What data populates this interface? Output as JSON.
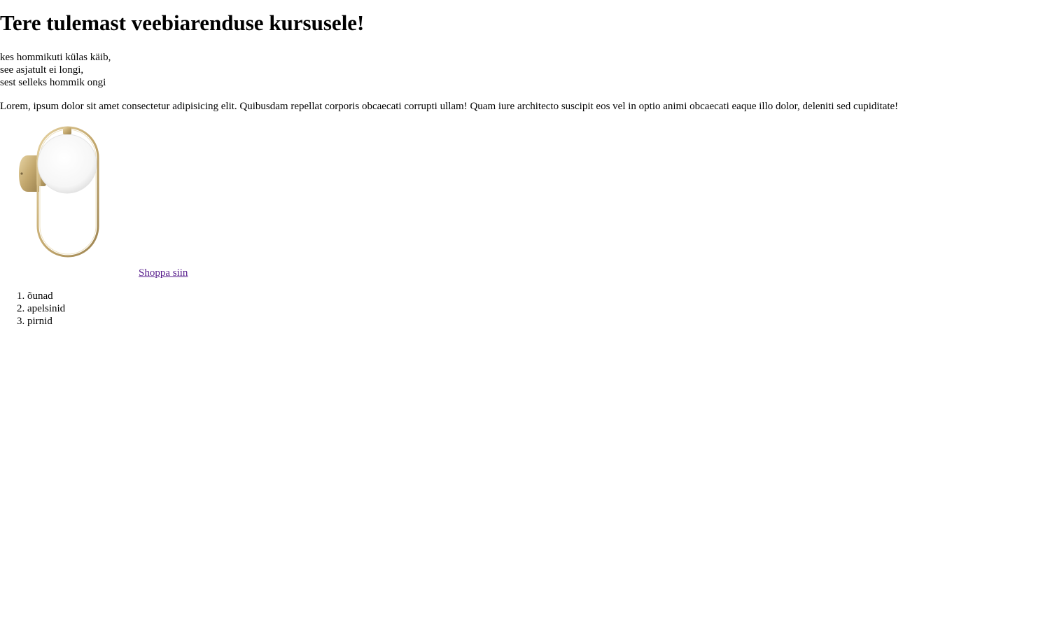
{
  "page": {
    "heading": "Tere tulemast veebiarenduse kursusele!",
    "poem": [
      "kes hommikuti külas käib,",
      "see asjatult ei longi,",
      "sest selleks hommik ongi"
    ],
    "paragraph": "Lorem, ipsum dolor sit amet consectetur adipisicing elit. Quibusdam repellat corporis obcaecati corrupti ullam! Quam iure architecto suscipit eos vel in optio animi obcaecati eaque illo dolor, deleniti sed cupiditate!",
    "image": {
      "icon": "wall-lamp-image"
    },
    "shop_link": "Shoppa siin",
    "fruits": [
      "õunad",
      "apelsinid",
      "pirnid"
    ]
  },
  "colors": {
    "text": "#000000",
    "visited_link": "#551a8b",
    "background": "#ffffff",
    "lamp_brass": "#c8b07a",
    "lamp_glass": "#ffffff"
  }
}
